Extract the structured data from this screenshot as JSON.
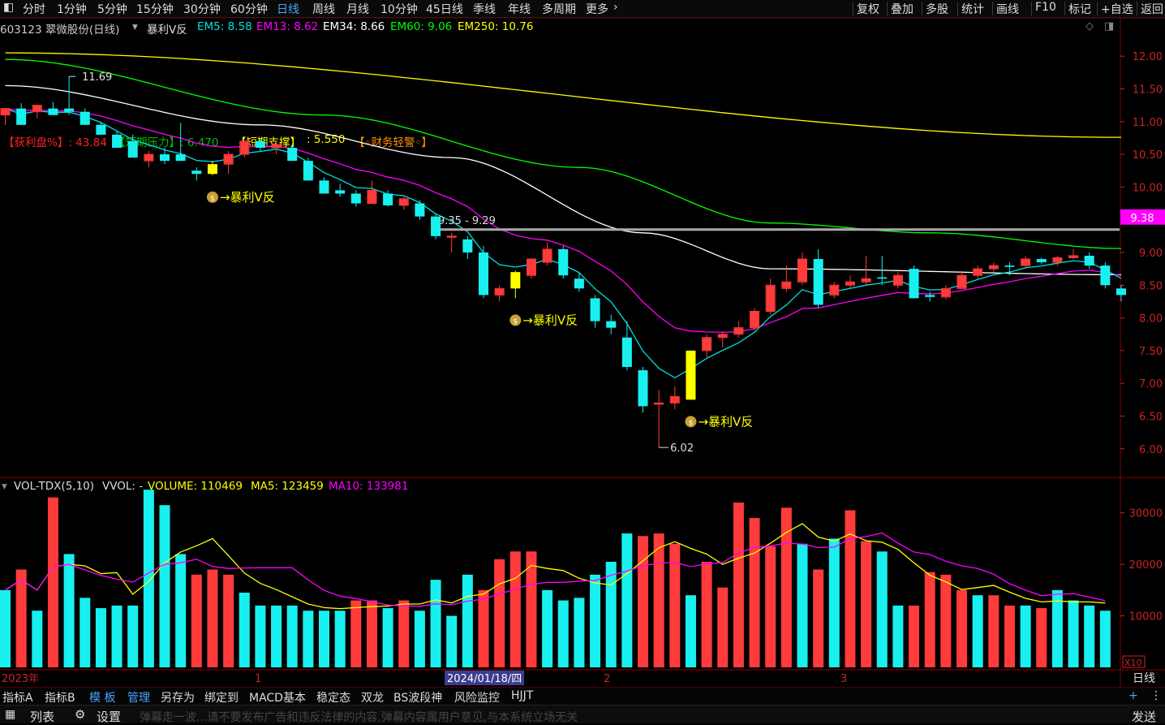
{
  "toolbar": {
    "items": [
      "分时",
      "1分钟",
      "5分钟",
      "15分钟",
      "30分钟",
      "60分钟",
      "日线",
      "周线",
      "月线",
      "10分钟",
      "45日线",
      "季线",
      "年线",
      "多周期",
      "更多"
    ],
    "active": "日线",
    "right_items": [
      "复权",
      "叠加",
      "多股",
      "统计",
      "画线",
      "F10",
      "标记",
      "+自选",
      "返回"
    ]
  },
  "header": {
    "stock": "603123 翠微股份(日线)",
    "indicator": "暴利V反",
    "ma": [
      {
        "label": "EM5: 8.58",
        "color": "#00e0e0"
      },
      {
        "label": "EM13: 8.62",
        "color": "#ff00ff"
      },
      {
        "label": "EM34: 8.66",
        "color": "#ffffff"
      },
      {
        "label": "EM60: 9.06",
        "color": "#00ff00"
      },
      {
        "label": "EM250: 10.76",
        "color": "#ffff00"
      }
    ]
  },
  "indicator_row": {
    "profit_label": "【获利盘%】: 43.84",
    "short_pressure": "【短期压力】: 6.470",
    "short_support_label": "【短期支撑】",
    "short_support_value": ": 5.550",
    "finance_warning": "【◦财务轻警◦】"
  },
  "annotations": {
    "high_label": "11.69",
    "low_label": "6.02",
    "signal_text": "暴利V反",
    "zone_label": "9.35 - 9.29",
    "current_price_tag": "9.38"
  },
  "volume_header": {
    "name": "VOL-TDX(5,10)",
    "vvol": "VVOL: -",
    "volume": "VOLUME: 110469",
    "ma5": "MA5: 123459",
    "ma10": "MA10: 133981"
  },
  "xaxis": {
    "year_label": "2023年",
    "month_1": "1",
    "cursor_date": "2024/01/18/四",
    "month_2": "2",
    "month_3": "3",
    "period_label": "日线",
    "scale_tag": "X10"
  },
  "bottom_tabs": [
    "指标A",
    "指标B",
    "模 板",
    "管理",
    "另存为",
    "绑定到",
    "MACD基本",
    "稳定态",
    "双龙",
    "BS波段神",
    "风险监控",
    "HJJT"
  ],
  "bottom_tabs_active": [
    "模 板",
    "管理"
  ],
  "status_bar": {
    "list_label": "列表",
    "settings_label": "设置",
    "ticker_text": "弹幕走一波...请不要发布广告和违反法律的内容,弹幕内容属用户意见,与本系统立场无关",
    "send_label": "发送",
    "plus_label": "+"
  },
  "chart_data": {
    "type": "candlestick",
    "price_axis": {
      "ticks": [
        12.0,
        11.5,
        11.0,
        10.5,
        10.0,
        9.5,
        9.0,
        8.5,
        8.0,
        7.5,
        7.0,
        6.5,
        6.0
      ],
      "range": [
        5.6,
        12.3
      ]
    },
    "volume_axis": {
      "ticks": [
        30000,
        20000,
        10000
      ],
      "range": [
        0,
        35000
      ]
    },
    "candles": [
      {
        "o": 11.1,
        "h": 11.2,
        "l": 10.95,
        "c": 11.2
      },
      {
        "o": 11.2,
        "h": 11.28,
        "l": 10.95,
        "c": 10.95
      },
      {
        "o": 11.15,
        "h": 11.25,
        "l": 11.05,
        "c": 11.25
      },
      {
        "o": 11.2,
        "h": 11.3,
        "l": 11.1,
        "c": 11.1
      },
      {
        "o": 11.2,
        "h": 11.69,
        "l": 11.1,
        "c": 11.15
      },
      {
        "o": 11.15,
        "h": 11.2,
        "l": 10.95,
        "c": 10.95
      },
      {
        "o": 10.95,
        "h": 11.0,
        "l": 10.8,
        "c": 10.8
      },
      {
        "o": 10.8,
        "h": 10.85,
        "l": 10.6,
        "c": 10.6
      },
      {
        "o": 10.7,
        "h": 10.8,
        "l": 10.45,
        "c": 10.45
      },
      {
        "o": 10.4,
        "h": 10.55,
        "l": 10.3,
        "c": 10.5
      },
      {
        "o": 10.5,
        "h": 10.6,
        "l": 10.35,
        "c": 10.4
      },
      {
        "o": 10.5,
        "h": 10.98,
        "l": 10.4,
        "c": 10.4
      },
      {
        "o": 10.25,
        "h": 10.3,
        "l": 10.1,
        "c": 10.2
      },
      {
        "o": 10.2,
        "h": 10.4,
        "l": 10.18,
        "c": 10.35,
        "signal": true
      },
      {
        "o": 10.35,
        "h": 10.55,
        "l": 10.2,
        "c": 10.5
      },
      {
        "o": 10.5,
        "h": 10.7,
        "l": 10.45,
        "c": 10.7
      },
      {
        "o": 10.7,
        "h": 10.75,
        "l": 10.55,
        "c": 10.6
      },
      {
        "o": 10.6,
        "h": 10.7,
        "l": 10.5,
        "c": 10.65
      },
      {
        "o": 10.6,
        "h": 10.65,
        "l": 10.4,
        "c": 10.4
      },
      {
        "o": 10.4,
        "h": 10.45,
        "l": 10.1,
        "c": 10.1
      },
      {
        "o": 10.1,
        "h": 10.15,
        "l": 9.9,
        "c": 9.9
      },
      {
        "o": 9.95,
        "h": 10.05,
        "l": 9.85,
        "c": 9.9
      },
      {
        "o": 9.9,
        "h": 9.95,
        "l": 9.7,
        "c": 9.75
      },
      {
        "o": 9.75,
        "h": 10.1,
        "l": 9.75,
        "c": 9.95
      },
      {
        "o": 9.9,
        "h": 9.95,
        "l": 9.7,
        "c": 9.72
      },
      {
        "o": 9.72,
        "h": 9.85,
        "l": 9.65,
        "c": 9.82
      },
      {
        "o": 9.75,
        "h": 9.8,
        "l": 9.5,
        "c": 9.55
      },
      {
        "o": 9.55,
        "h": 9.6,
        "l": 9.2,
        "c": 9.25
      },
      {
        "o": 9.25,
        "h": 9.3,
        "l": 9.0,
        "c": 9.25
      },
      {
        "o": 9.2,
        "h": 9.25,
        "l": 8.9,
        "c": 9.0
      },
      {
        "o": 9.0,
        "h": 9.1,
        "l": 8.3,
        "c": 8.35
      },
      {
        "o": 8.35,
        "h": 8.5,
        "l": 8.25,
        "c": 8.45
      },
      {
        "o": 8.45,
        "h": 8.72,
        "l": 8.3,
        "c": 8.7,
        "signal": true
      },
      {
        "o": 8.65,
        "h": 8.9,
        "l": 8.6,
        "c": 8.9
      },
      {
        "o": 8.85,
        "h": 9.15,
        "l": 8.8,
        "c": 9.05
      },
      {
        "o": 9.05,
        "h": 9.1,
        "l": 8.6,
        "c": 8.65
      },
      {
        "o": 8.6,
        "h": 8.7,
        "l": 8.4,
        "c": 8.45
      },
      {
        "o": 8.3,
        "h": 8.35,
        "l": 7.85,
        "c": 7.95
      },
      {
        "o": 7.95,
        "h": 8.05,
        "l": 7.75,
        "c": 7.85
      },
      {
        "o": 7.7,
        "h": 7.95,
        "l": 7.2,
        "c": 7.25
      },
      {
        "o": 7.2,
        "h": 7.25,
        "l": 6.55,
        "c": 6.65
      },
      {
        "o": 6.7,
        "h": 6.9,
        "l": 6.02,
        "c": 6.7
      },
      {
        "o": 6.7,
        "h": 6.95,
        "l": 6.6,
        "c": 6.8
      },
      {
        "o": 6.75,
        "h": 7.5,
        "l": 6.75,
        "c": 7.5,
        "signal": true
      },
      {
        "o": 7.5,
        "h": 7.75,
        "l": 7.4,
        "c": 7.7
      },
      {
        "o": 7.7,
        "h": 7.8,
        "l": 7.55,
        "c": 7.75
      },
      {
        "o": 7.75,
        "h": 7.95,
        "l": 7.7,
        "c": 7.85
      },
      {
        "o": 7.85,
        "h": 8.15,
        "l": 7.8,
        "c": 8.1
      },
      {
        "o": 8.1,
        "h": 8.6,
        "l": 8.05,
        "c": 8.5
      },
      {
        "o": 8.45,
        "h": 8.8,
        "l": 8.4,
        "c": 8.55
      },
      {
        "o": 8.55,
        "h": 9.0,
        "l": 8.5,
        "c": 8.9
      },
      {
        "o": 8.9,
        "h": 9.05,
        "l": 8.15,
        "c": 8.2
      },
      {
        "o": 8.35,
        "h": 8.55,
        "l": 8.3,
        "c": 8.5
      },
      {
        "o": 8.5,
        "h": 8.65,
        "l": 8.45,
        "c": 8.55
      },
      {
        "o": 8.55,
        "h": 8.95,
        "l": 8.5,
        "c": 8.6
      },
      {
        "o": 8.62,
        "h": 8.95,
        "l": 8.5,
        "c": 8.6
      },
      {
        "o": 8.5,
        "h": 8.7,
        "l": 8.45,
        "c": 8.65
      },
      {
        "o": 8.75,
        "h": 8.8,
        "l": 8.3,
        "c": 8.3
      },
      {
        "o": 8.35,
        "h": 8.4,
        "l": 8.25,
        "c": 8.32
      },
      {
        "o": 8.32,
        "h": 8.5,
        "l": 8.28,
        "c": 8.45
      },
      {
        "o": 8.45,
        "h": 8.7,
        "l": 8.45,
        "c": 8.65
      },
      {
        "o": 8.65,
        "h": 8.8,
        "l": 8.6,
        "c": 8.75
      },
      {
        "o": 8.75,
        "h": 8.85,
        "l": 8.7,
        "c": 8.8
      },
      {
        "o": 8.8,
        "h": 8.85,
        "l": 8.65,
        "c": 8.78
      },
      {
        "o": 8.8,
        "h": 8.95,
        "l": 8.75,
        "c": 8.9
      },
      {
        "o": 8.9,
        "h": 8.92,
        "l": 8.82,
        "c": 8.85
      },
      {
        "o": 8.85,
        "h": 8.95,
        "l": 8.8,
        "c": 8.92
      },
      {
        "o": 8.92,
        "h": 9.05,
        "l": 8.9,
        "c": 8.95
      },
      {
        "o": 8.95,
        "h": 9.0,
        "l": 8.75,
        "c": 8.8
      },
      {
        "o": 8.8,
        "h": 8.85,
        "l": 8.45,
        "c": 8.5
      },
      {
        "o": 8.45,
        "h": 8.5,
        "l": 8.25,
        "c": 8.35
      }
    ],
    "volume": [
      15000,
      19000,
      11000,
      33000,
      22000,
      13500,
      11500,
      12000,
      12000,
      34500,
      31500,
      22000,
      18000,
      19000,
      18000,
      14500,
      12000,
      12000,
      12000,
      11000,
      11000,
      11000,
      13000,
      13000,
      11500,
      13000,
      11000,
      17000,
      10000,
      18000,
      15000,
      21000,
      22500,
      22500,
      15000,
      13000,
      13500,
      18000,
      20500,
      26000,
      25500,
      26000,
      24000,
      14000,
      20500,
      15500,
      32000,
      29000,
      23500,
      31000,
      24000,
      19000,
      25000,
      30500,
      24500,
      22500,
      12000,
      12000,
      18500,
      18000,
      15000,
      14000,
      14000,
      12000,
      12000,
      11500,
      15000,
      13000,
      12000,
      11000
    ],
    "volume_up": [
      false,
      true,
      false,
      true,
      false,
      false,
      false,
      false,
      false,
      false,
      false,
      false,
      true,
      true,
      true,
      false,
      false,
      false,
      false,
      false,
      false,
      false,
      true,
      true,
      false,
      true,
      false,
      false,
      false,
      false,
      true,
      true,
      true,
      true,
      false,
      false,
      false,
      false,
      false,
      false,
      true,
      true,
      true,
      false,
      true,
      true,
      true,
      true,
      true,
      true,
      false,
      true,
      false,
      true,
      true,
      false,
      false,
      true,
      true,
      true,
      true,
      false,
      true,
      true,
      false,
      true,
      false,
      false,
      false,
      false
    ],
    "ma_lines": [
      {
        "name": "EM5",
        "color": "#00e0e0"
      },
      {
        "name": "EM13",
        "color": "#ff00ff"
      },
      {
        "name": "EM34",
        "color": "#ffffff"
      },
      {
        "name": "EM60",
        "color": "#00ff00"
      },
      {
        "name": "EM250",
        "color": "#ffff00"
      }
    ],
    "em34_points": [
      [
        0,
        11.55
      ],
      [
        16,
        10.95
      ],
      [
        28,
        10.45
      ],
      [
        40,
        9.3
      ],
      [
        48,
        8.75
      ],
      [
        70,
        8.66
      ]
    ],
    "em60_points": [
      [
        0,
        11.95
      ],
      [
        20,
        11.1
      ],
      [
        36,
        10.3
      ],
      [
        48,
        9.45
      ],
      [
        58,
        9.3
      ],
      [
        70,
        9.06
      ]
    ],
    "em250_points": [
      [
        0,
        12.05
      ],
      [
        70,
        10.76
      ]
    ],
    "zone_price": 9.35
  }
}
